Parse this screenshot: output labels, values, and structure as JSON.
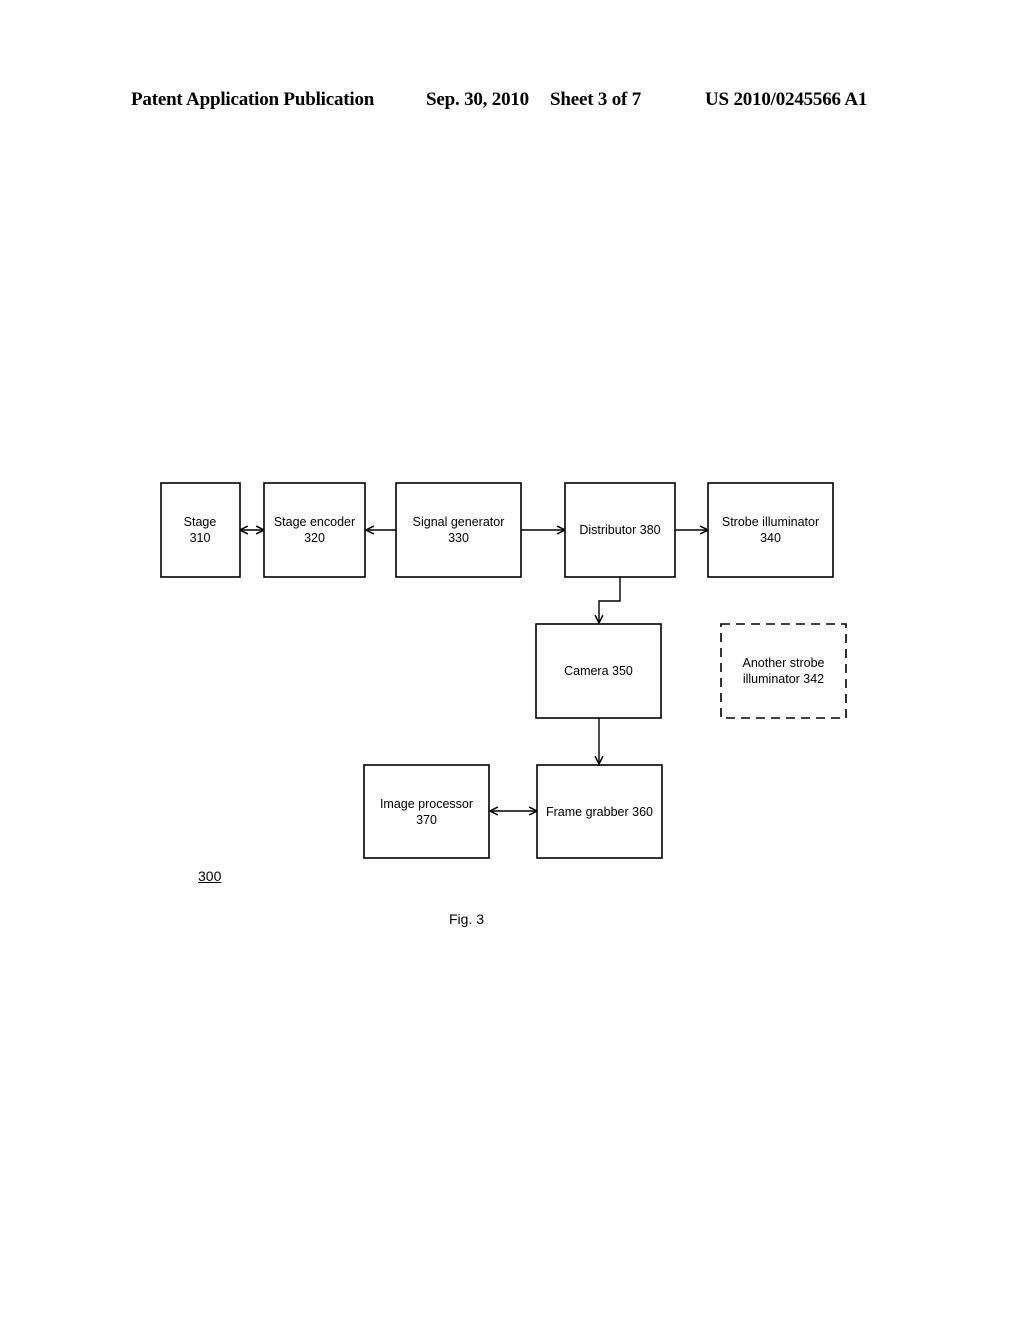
{
  "header": {
    "publication": "Patent Application Publication",
    "date": "Sep. 30, 2010",
    "sheet": "Sheet 3 of 7",
    "number": "US 2010/0245566 A1"
  },
  "diagram": {
    "blocks": {
      "stage": {
        "line1": "Stage",
        "line2": "310"
      },
      "stage_encoder": {
        "line1": "Stage encoder",
        "line2": "320"
      },
      "signal_generator": {
        "line1": "Signal generator",
        "line2": "330"
      },
      "distributor": {
        "line1": "Distributor 380"
      },
      "strobe_illuminator": {
        "line1": "Strobe illuminator",
        "line2": "340"
      },
      "camera": {
        "line1": "Camera 350"
      },
      "another_strobe": {
        "line1": "Another strobe",
        "line2": "illuminator 342",
        "style": "dashed"
      },
      "image_processor": {
        "line1": "Image processor",
        "line2": "370"
      },
      "frame_grabber": {
        "line1": "Frame grabber 360"
      }
    },
    "connections": [
      {
        "from": "stage",
        "to": "stage_encoder",
        "type": "bidirectional"
      },
      {
        "from": "signal_generator",
        "to": "stage_encoder",
        "type": "directed"
      },
      {
        "from": "signal_generator",
        "to": "distributor",
        "type": "directed"
      },
      {
        "from": "distributor",
        "to": "strobe_illuminator",
        "type": "directed"
      },
      {
        "from": "distributor",
        "to": "camera",
        "type": "directed"
      },
      {
        "from": "camera",
        "to": "frame_grabber",
        "type": "directed"
      },
      {
        "from": "image_processor",
        "to": "frame_grabber",
        "type": "bidirectional"
      }
    ],
    "reference_numeral": "300",
    "caption": "Fig. 3"
  }
}
